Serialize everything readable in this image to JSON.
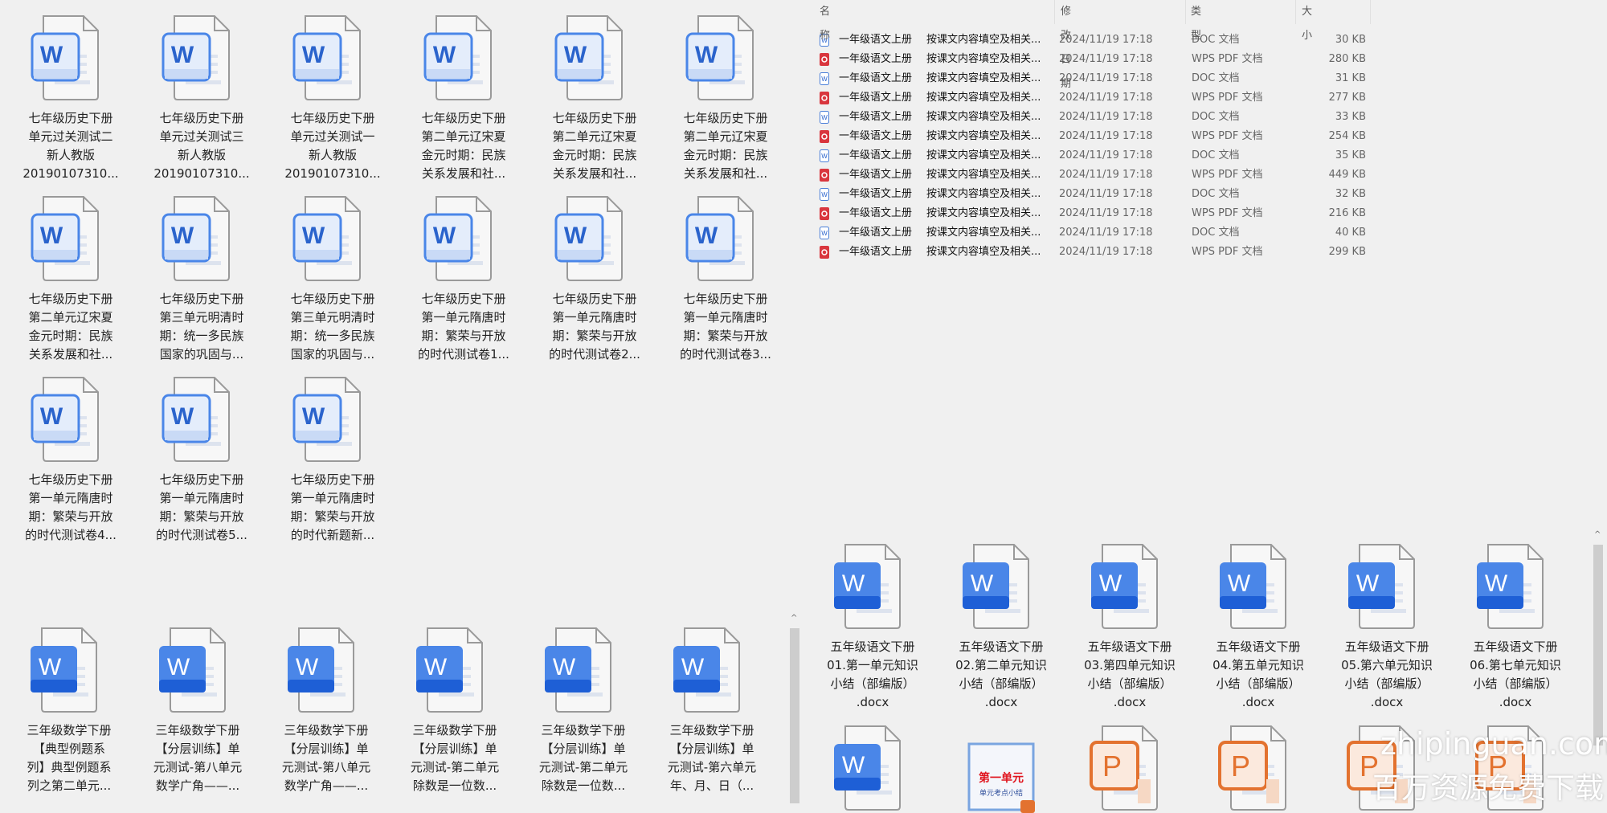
{
  "top_left_grid": {
    "items": [
      {
        "icon": "word-doc-icon",
        "lines": [
          "七年级历史下册",
          "单元过关测试二",
          "新人教版",
          "20190107310..."
        ]
      },
      {
        "icon": "word-doc-icon",
        "lines": [
          "七年级历史下册",
          "单元过关测试三",
          "新人教版",
          "20190107310..."
        ]
      },
      {
        "icon": "word-doc-icon",
        "lines": [
          "七年级历史下册",
          "单元过关测试一",
          "新人教版",
          "20190107310..."
        ]
      },
      {
        "icon": "word-doc-icon",
        "lines": [
          "七年级历史下册",
          "第二单元辽宋夏",
          "金元时期：民族",
          "关系发展和社..."
        ]
      },
      {
        "icon": "word-doc-icon",
        "lines": [
          "七年级历史下册",
          "第二单元辽宋夏",
          "金元时期：民族",
          "关系发展和社..."
        ]
      },
      {
        "icon": "word-doc-icon",
        "lines": [
          "七年级历史下册",
          "第二单元辽宋夏",
          "金元时期：民族",
          "关系发展和社..."
        ]
      },
      {
        "icon": "word-doc-icon",
        "lines": [
          "七年级历史下册",
          "第二单元辽宋夏",
          "金元时期：民族",
          "关系发展和社..."
        ]
      },
      {
        "icon": "word-doc-icon",
        "lines": [
          "七年级历史下册",
          "第三单元明清时",
          "期：统一多民族",
          "国家的巩固与..."
        ]
      },
      {
        "icon": "word-doc-icon",
        "lines": [
          "七年级历史下册",
          "第三单元明清时",
          "期：统一多民族",
          "国家的巩固与..."
        ]
      },
      {
        "icon": "word-doc-icon",
        "lines": [
          "七年级历史下册",
          "第一单元隋唐时",
          "期：繁荣与开放",
          "的时代测试卷1..."
        ]
      },
      {
        "icon": "word-doc-icon",
        "lines": [
          "七年级历史下册",
          "第一单元隋唐时",
          "期：繁荣与开放",
          "的时代测试卷2..."
        ]
      },
      {
        "icon": "word-doc-icon",
        "lines": [
          "七年级历史下册",
          "第一单元隋唐时",
          "期：繁荣与开放",
          "的时代测试卷3..."
        ]
      },
      {
        "icon": "word-doc-icon",
        "lines": [
          "七年级历史下册",
          "第一单元隋唐时",
          "期：繁荣与开放",
          "的时代测试卷4..."
        ]
      },
      {
        "icon": "word-doc-icon",
        "lines": [
          "七年级历史下册",
          "第一单元隋唐时",
          "期：繁荣与开放",
          "的时代测试卷5..."
        ]
      },
      {
        "icon": "word-doc-icon",
        "lines": [
          "七年级历史下册",
          "第一单元隋唐时",
          "期：繁荣与开放",
          "的时代新题新..."
        ]
      }
    ]
  },
  "detail_list": {
    "columns": {
      "name": "名称",
      "date": "修改日期",
      "type": "类型",
      "size": "大小"
    },
    "rows": [
      {
        "icon": "doc",
        "name": "一年级语文上册",
        "name2": "按课文内容填空及相关...",
        "date": "2024/11/19 17:18",
        "type": "DOC 文档",
        "size": "30 KB"
      },
      {
        "icon": "pdf",
        "name": "一年级语文上册",
        "name2": "按课文内容填空及相关...",
        "date": "2024/11/19 17:18",
        "type": "WPS PDF 文档",
        "size": "280 KB"
      },
      {
        "icon": "doc",
        "name": "一年级语文上册",
        "name2": "按课文内容填空及相关...",
        "date": "2024/11/19 17:18",
        "type": "DOC 文档",
        "size": "31 KB"
      },
      {
        "icon": "pdf",
        "name": "一年级语文上册",
        "name2": "按课文内容填空及相关...",
        "date": "2024/11/19 17:18",
        "type": "WPS PDF 文档",
        "size": "277 KB"
      },
      {
        "icon": "doc",
        "name": "一年级语文上册",
        "name2": "按课文内容填空及相关...",
        "date": "2024/11/19 17:18",
        "type": "DOC 文档",
        "size": "33 KB"
      },
      {
        "icon": "pdf",
        "name": "一年级语文上册",
        "name2": "按课文内容填空及相关...",
        "date": "2024/11/19 17:18",
        "type": "WPS PDF 文档",
        "size": "254 KB"
      },
      {
        "icon": "doc",
        "name": "一年级语文上册",
        "name2": "按课文内容填空及相关...",
        "date": "2024/11/19 17:18",
        "type": "DOC 文档",
        "size": "35 KB"
      },
      {
        "icon": "pdf",
        "name": "一年级语文上册",
        "name2": "按课文内容填空及相关...",
        "date": "2024/11/19 17:18",
        "type": "WPS PDF 文档",
        "size": "449 KB"
      },
      {
        "icon": "doc",
        "name": "一年级语文上册",
        "name2": "按课文内容填空及相关...",
        "date": "2024/11/19 17:18",
        "type": "DOC 文档",
        "size": "32 KB"
      },
      {
        "icon": "pdf",
        "name": "一年级语文上册",
        "name2": "按课文内容填空及相关...",
        "date": "2024/11/19 17:18",
        "type": "WPS PDF 文档",
        "size": "216 KB"
      },
      {
        "icon": "doc",
        "name": "一年级语文上册",
        "name2": "按课文内容填空及相关...",
        "date": "2024/11/19 17:18",
        "type": "DOC 文档",
        "size": "40 KB"
      },
      {
        "icon": "pdf",
        "name": "一年级语文上册",
        "name2": "按课文内容填空及相关...",
        "date": "2024/11/19 17:18",
        "type": "WPS PDF 文档",
        "size": "299 KB"
      }
    ]
  },
  "bottom_left_grid": {
    "items": [
      {
        "icon": "word-doc-icon",
        "lines": [
          "三年级数学下册",
          "【典型例题系",
          "列】典型例题系",
          "列之第二单元..."
        ]
      },
      {
        "icon": "word-doc-icon",
        "lines": [
          "三年级数学下册",
          "【分层训练】单",
          "元测试-第八单元",
          "数学广角——..."
        ]
      },
      {
        "icon": "word-doc-icon",
        "lines": [
          "三年级数学下册",
          "【分层训练】单",
          "元测试-第八单元",
          "数学广角——..."
        ]
      },
      {
        "icon": "word-doc-icon",
        "lines": [
          "三年级数学下册",
          "【分层训练】单",
          "元测试-第二单元",
          "除数是一位数..."
        ]
      },
      {
        "icon": "word-doc-icon",
        "lines": [
          "三年级数学下册",
          "【分层训练】单",
          "元测试-第二单元",
          "除数是一位数..."
        ]
      },
      {
        "icon": "word-doc-icon",
        "lines": [
          "三年级数学下册",
          "【分层训练】单",
          "元测试-第六单元",
          "年、月、日（..."
        ]
      }
    ]
  },
  "bottom_right_grid": {
    "items": [
      {
        "icon": "word-doc-icon",
        "lines": [
          "五年级语文下册",
          "01.第一单元知识",
          "小结（部编版）",
          ".docx"
        ]
      },
      {
        "icon": "word-doc-icon",
        "lines": [
          "五年级语文下册",
          "02.第二单元知识",
          "小结（部编版）",
          ".docx"
        ]
      },
      {
        "icon": "word-doc-icon",
        "lines": [
          "五年级语文下册",
          "03.第四单元知识",
          "小结（部编版）",
          ".docx"
        ]
      },
      {
        "icon": "word-doc-icon",
        "lines": [
          "五年级语文下册",
          "04.第五单元知识",
          "小结（部编版）",
          ".docx"
        ]
      },
      {
        "icon": "word-doc-icon",
        "lines": [
          "五年级语文下册",
          "05.第六单元知识",
          "小结（部编版）",
          ".docx"
        ]
      },
      {
        "icon": "word-doc-icon",
        "lines": [
          "五年级语文下册",
          "06.第七单元知识",
          "小结（部编版）",
          ".docx"
        ]
      },
      {
        "icon": "word-doc-icon",
        "lines": []
      },
      {
        "icon": "ppt-thumbnail-icon",
        "lines": [],
        "thumb_title": "第一单元",
        "thumb_sub": "单元考点小结"
      },
      {
        "icon": "powerpoint-icon",
        "lines": []
      },
      {
        "icon": "powerpoint-icon",
        "lines": []
      },
      {
        "icon": "powerpoint-icon",
        "lines": []
      },
      {
        "icon": "powerpoint-icon",
        "lines": []
      }
    ]
  },
  "watermark": {
    "line1": "zhipinguan.com",
    "line2": "百万资源免费下载"
  },
  "colors": {
    "word_blue": "#1e5fd6",
    "word_light": "#4a86e8",
    "ppt_orange": "#e3722f",
    "pdf_red": "#d9363e",
    "bg": "#f0f0f0"
  }
}
